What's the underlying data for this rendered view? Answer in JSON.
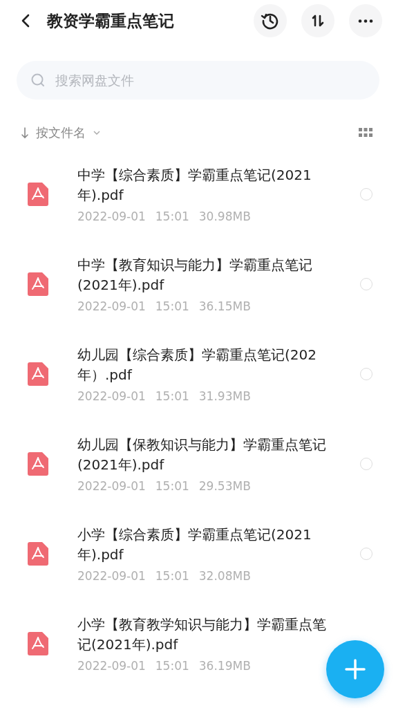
{
  "header": {
    "title": "教资学霸重点笔记"
  },
  "search": {
    "placeholder": "搜索网盘文件"
  },
  "sort": {
    "label": "按文件名"
  },
  "files": [
    {
      "name": "中学【综合素质】学霸重点笔记(2021年).pdf",
      "date": "2022-09-01",
      "time": "15:01",
      "size": "30.98MB",
      "selected": false
    },
    {
      "name": "中学【教育知识与能力】学霸重点笔记(2021年).pdf",
      "date": "2022-09-01",
      "time": "15:01",
      "size": "36.15MB",
      "selected": false
    },
    {
      "name": "幼儿园【综合素质】学霸重点笔记(202年）.pdf",
      "date": "2022-09-01",
      "time": "15:01",
      "size": "31.93MB",
      "selected": false
    },
    {
      "name": "幼儿园【保教知识与能力】学霸重点笔记(2021年).pdf",
      "date": "2022-09-01",
      "time": "15:01",
      "size": "29.53MB",
      "selected": false
    },
    {
      "name": "小学【综合素质】学霸重点笔记(2021年).pdf",
      "date": "2022-09-01",
      "time": "15:01",
      "size": "32.08MB",
      "selected": false
    },
    {
      "name": "小学【教育教学知识与能力】学霸重点笔记(2021年).pdf",
      "date": "2022-09-01",
      "time": "15:01",
      "size": "36.19MB"
    }
  ]
}
